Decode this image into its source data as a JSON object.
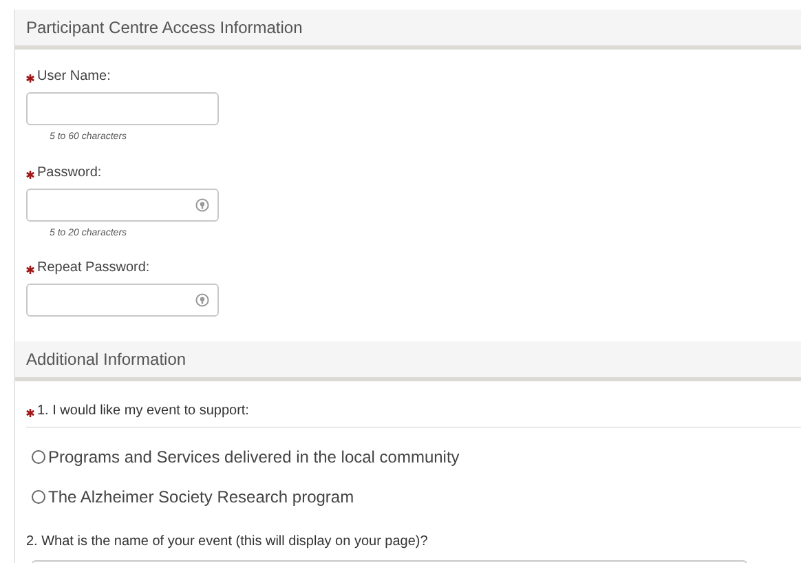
{
  "sections": [
    {
      "title": "Participant Centre Access Information",
      "fields": [
        {
          "label": "User Name:",
          "required": true,
          "kind": "text",
          "hint": "5 to 60 characters"
        },
        {
          "label": "Password:",
          "required": true,
          "kind": "password",
          "hint": "5 to 20 characters"
        },
        {
          "label": "Repeat Password:",
          "required": true,
          "kind": "password"
        }
      ]
    },
    {
      "title": "Additional Information",
      "questions": [
        {
          "label": "1. I would like my event to support:",
          "required": true,
          "options": [
            {
              "label": "Programs and Services delivered in the local community",
              "selected": false
            },
            {
              "label": "The Alzheimer Society Research program",
              "selected": false
            }
          ]
        },
        {
          "label": "2. What is the name of your event (this will display on your page)?",
          "required": false,
          "kind": "text"
        }
      ]
    }
  ]
}
